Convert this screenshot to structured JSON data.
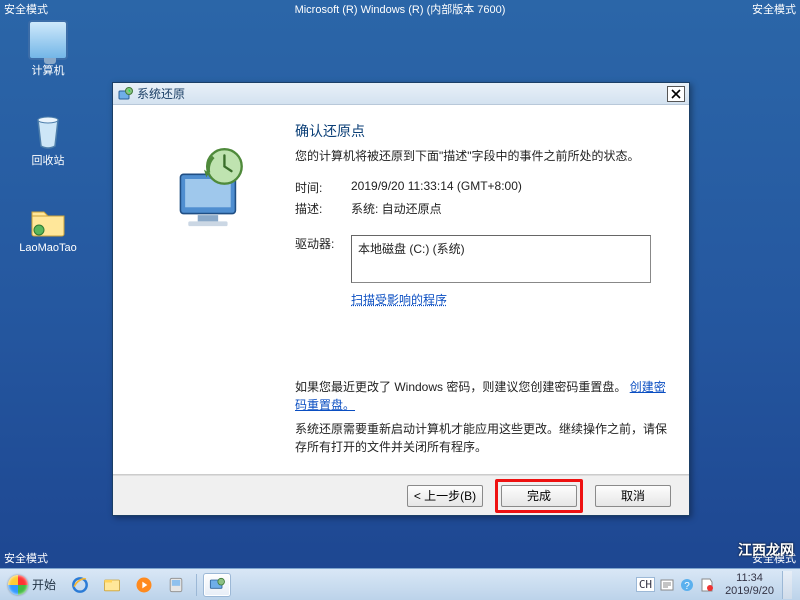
{
  "safe_mode_label": "安全模式",
  "os_title": "Microsoft (R) Windows (R) (内部版本 7600)",
  "desktop": {
    "computer": "计算机",
    "recycle": "回收站",
    "folder": "LaoMaoTao"
  },
  "watermark": "江西龙网",
  "taskbar": {
    "start_label": "开始",
    "ime_lang": "CH",
    "clock_time": "11:34",
    "clock_date": "2019/9/20"
  },
  "dialog": {
    "title": "系统还原",
    "heading": "确认还原点",
    "subheading": "您的计算机将被还原到下面\"描述\"字段中的事件之前所处的状态。",
    "time_label": "时间:",
    "time_value": "2019/9/20 11:33:14 (GMT+8:00)",
    "desc_label": "描述:",
    "desc_value": "系统: 自动还原点",
    "drives_label": "驱动器:",
    "drive_text": "本地磁盘 (C:) (系统)",
    "scan_link": "扫描受影响的程序",
    "note1_a": "如果您最近更改了 Windows 密码，则建议您创建密码重置盘。",
    "note1_link": "创建密码重置盘。",
    "note2": "系统还原需要重新启动计算机才能应用这些更改。继续操作之前，请保存所有打开的文件并关闭所有程序。",
    "btn_back": "< 上一步(B)",
    "btn_finish": "完成",
    "btn_cancel": "取消"
  }
}
